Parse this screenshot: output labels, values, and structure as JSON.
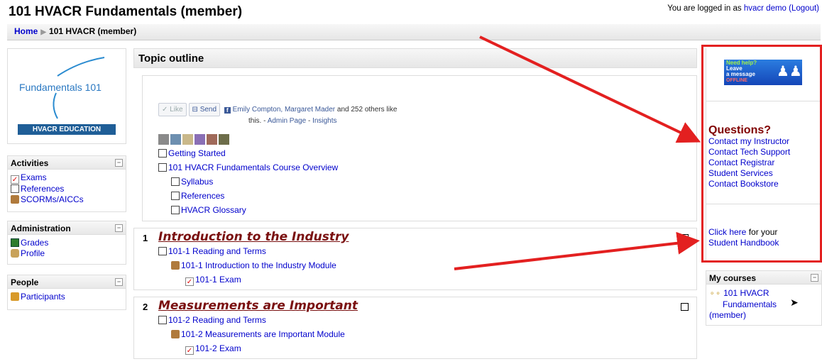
{
  "header": {
    "title": "101 HVACR Fundamentals (member)",
    "login_prefix": "You are logged in as ",
    "user": "hvacr demo",
    "logout": "(Logout)"
  },
  "breadcrumb": {
    "home": "Home",
    "current": "101 HVACR (member)"
  },
  "logo": {
    "line1": "Fundamentals 101",
    "badge": "HVACR EDUCATION"
  },
  "blocks": {
    "activities": {
      "title": "Activities",
      "items": [
        "Exams",
        "References",
        "SCORMs/AICCs"
      ]
    },
    "administration": {
      "title": "Administration",
      "items": [
        "Grades",
        "Profile"
      ]
    },
    "people": {
      "title": "People",
      "items": [
        "Participants"
      ]
    }
  },
  "main": {
    "title": "Topic outline",
    "facebook": {
      "like": "Like",
      "send": "Send",
      "names": "Emily Compton, Margaret Mader",
      "others": " and 252 others like",
      "this": "this.",
      "sep": " - ",
      "admin": "Admin Page",
      "insights": "Insights"
    },
    "intro_items": [
      "Getting Started",
      "101 HVACR Fundamentals Course Overview",
      "Syllabus",
      "References",
      "HVACR Glossary"
    ],
    "sections": [
      {
        "num": "1",
        "title": "Introduction to the Industry",
        "items": [
          "101-1 Reading and Terms",
          "101-1 Introduction to the Industry Module",
          "101-1 Exam"
        ]
      },
      {
        "num": "2",
        "title": "Measurements are Important",
        "items": [
          "101-2 Reading and Terms",
          "101-2 Measurements are Important Module",
          "101-2 Exam"
        ]
      }
    ]
  },
  "right": {
    "help_banner": {
      "line1": "Need help?",
      "line2": "Leave",
      "line3": "a message",
      "status": "OFFLINE"
    },
    "questions": {
      "title": "Questions?",
      "links": [
        "Contact my Instructor",
        "Contact Tech Support",
        "Contact Registrar",
        "Student Services",
        "Contact Bookstore"
      ]
    },
    "handbook": {
      "link": "Click here",
      "text": " for your",
      "link2": "Student Handbook"
    },
    "my_courses": {
      "title": "My courses",
      "item_line1": "101 HVACR",
      "item_line2": "Fundamentals",
      "item_line3": "(member)"
    }
  },
  "colors": {
    "link": "#0000cc",
    "section_title": "#7a1010",
    "annotation": "#e32020",
    "questions": "#800000"
  }
}
